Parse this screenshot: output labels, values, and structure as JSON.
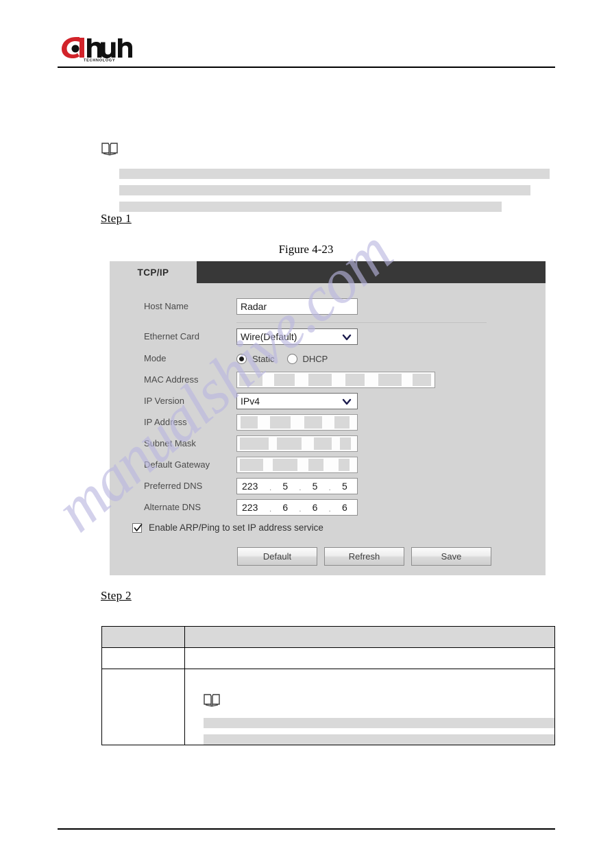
{
  "document": {
    "brand": "alhua",
    "brand_sub": "TECHNOLOGY",
    "figure_caption": "Figure 4-23",
    "step_1": "Step 1",
    "step_2": "Step 2",
    "note_icon_name": "note-book-icon"
  },
  "panel": {
    "tab_label": "TCP/IP",
    "fields": {
      "host_name_label": "Host Name",
      "host_name_value": "Radar",
      "ethernet_card_label": "Ethernet Card",
      "ethernet_card_value": "Wire(Default)",
      "mode_label": "Mode",
      "mode_static": "Static",
      "mode_dhcp": "DHCP",
      "mode_selected": "Static",
      "mac_address_label": "MAC Address",
      "mac_address_value": "",
      "ip_version_label": "IP Version",
      "ip_version_value": "IPv4",
      "ip_address_label": "IP Address",
      "ip_address_value": "",
      "subnet_mask_label": "Subnet Mask",
      "subnet_mask_value": "",
      "default_gateway_label": "Default Gateway",
      "default_gateway_value": "",
      "preferred_dns_label": "Preferred DNS",
      "preferred_dns": [
        "223",
        "5",
        "5",
        "5"
      ],
      "alternate_dns_label": "Alternate DNS",
      "alternate_dns": [
        "223",
        "6",
        "6",
        "6"
      ]
    },
    "checkbox": {
      "label": "Enable ARP/Ping to set IP address service",
      "checked": true
    },
    "buttons": {
      "default": "Default",
      "refresh": "Refresh",
      "save": "Save"
    }
  },
  "watermark": {
    "text": "manualshive.com",
    "color": "#b9b6e0"
  },
  "colors": {
    "panel_background": "#d4d4d4",
    "panel_header_dark": "#383838",
    "redaction_gray": "#d9d9d9",
    "brand_red": "#d2232a",
    "table_header_gray": "#d9d9d9"
  }
}
